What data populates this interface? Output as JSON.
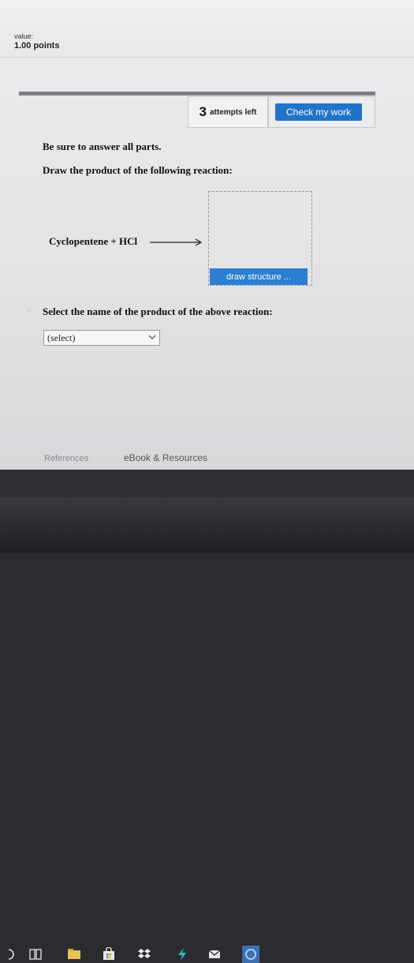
{
  "header": {
    "value_label": "value:",
    "points": "1.00 points"
  },
  "toolbar": {
    "attempts_number": "3",
    "attempts_text": "attempts left",
    "check_label": "Check my work"
  },
  "question": {
    "instruction1": "Be sure to answer all parts.",
    "instruction2": "Draw the product of the following reaction:",
    "reaction_text": "Cyclopentene + HCl",
    "draw_button": "draw structure ...",
    "select_question": "Select the name of the product of the above reaction:",
    "select_value": "(select)"
  },
  "footer": {
    "references": "References",
    "ebook": "eBook & Resources"
  },
  "taskbar": {
    "icons": [
      "back-icon",
      "task-view-icon",
      "file-explorer-icon",
      "store-icon",
      "dropbox-icon",
      "bolt-app-icon",
      "mail-icon",
      "edge-icon"
    ]
  },
  "colors": {
    "accent": "#1f74c9",
    "taskbar": "#2f3036"
  }
}
